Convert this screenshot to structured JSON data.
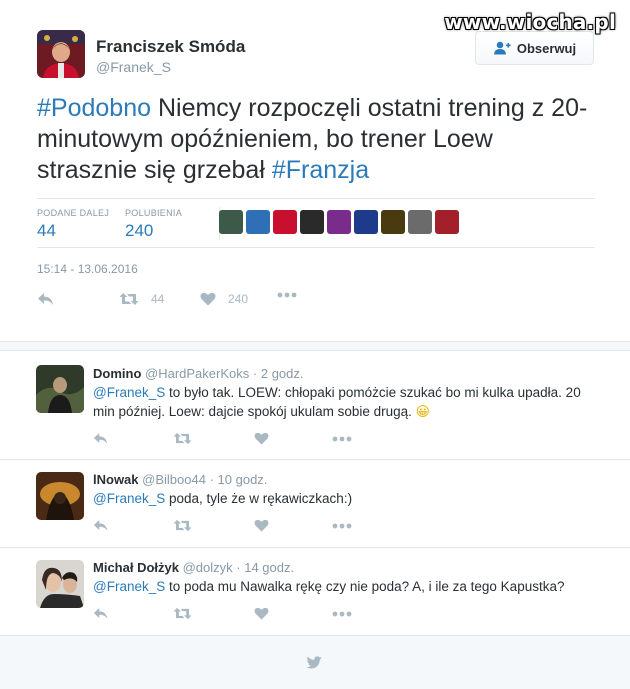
{
  "watermark": "www.wiocha.pl",
  "tweet": {
    "author_name": "Franciszek Smóda",
    "author_handle": "@Franek_S",
    "follow_label": "Obserwuj",
    "text_parts": [
      "#Podobno",
      " Niemcy rozpoczęli ostatni trening z 20-minutowym opóźnieniem, bo trener Loew strasznie się grzebał ",
      "#Franzja"
    ],
    "retweets_label": "PODANE DALEJ",
    "retweets_value": "44",
    "likes_label": "POLUBIENIA",
    "likes_value": "240",
    "timestamp": "15:14 - 13.06.2016",
    "action_retweet_count": "44",
    "action_like_count": "240",
    "liker_colors": [
      "#3d5a48",
      "#2f6fb5",
      "#c8102e",
      "#2a2a2a",
      "#7a2c8c",
      "#1e3a8a",
      "#4a3a10",
      "#6b6b6b",
      "#a31f2a"
    ]
  },
  "replies": [
    {
      "name": "Domino",
      "handle": "@HardPakerKoks",
      "time": "2 godz.",
      "mention": "@Franek_S",
      "text": " to było tak. LOEW: chłopaki pomóżcie szukać bo mi kulka upadła. 20 min później. Loew: dajcie spokój ukulam sobie drugą.",
      "emoji": "😀"
    },
    {
      "name": "lNowak",
      "handle": "@Bilboo44",
      "time": "10 godz.",
      "mention": "@Franek_S",
      "text": " poda, tyle że w rękawiczkach:)"
    },
    {
      "name": "Michał Dołżyk",
      "handle": "@dolzyk",
      "time": "14 godz.",
      "mention": "@Franek_S",
      "text": " to poda mu Nawalka rękę czy nie poda? A, i ile za tego Kapustka?"
    }
  ],
  "colors": {
    "link": "#2b7bb9",
    "muted": "#8899a6",
    "icon": "#aab8c2",
    "border": "#e1e8ed"
  }
}
